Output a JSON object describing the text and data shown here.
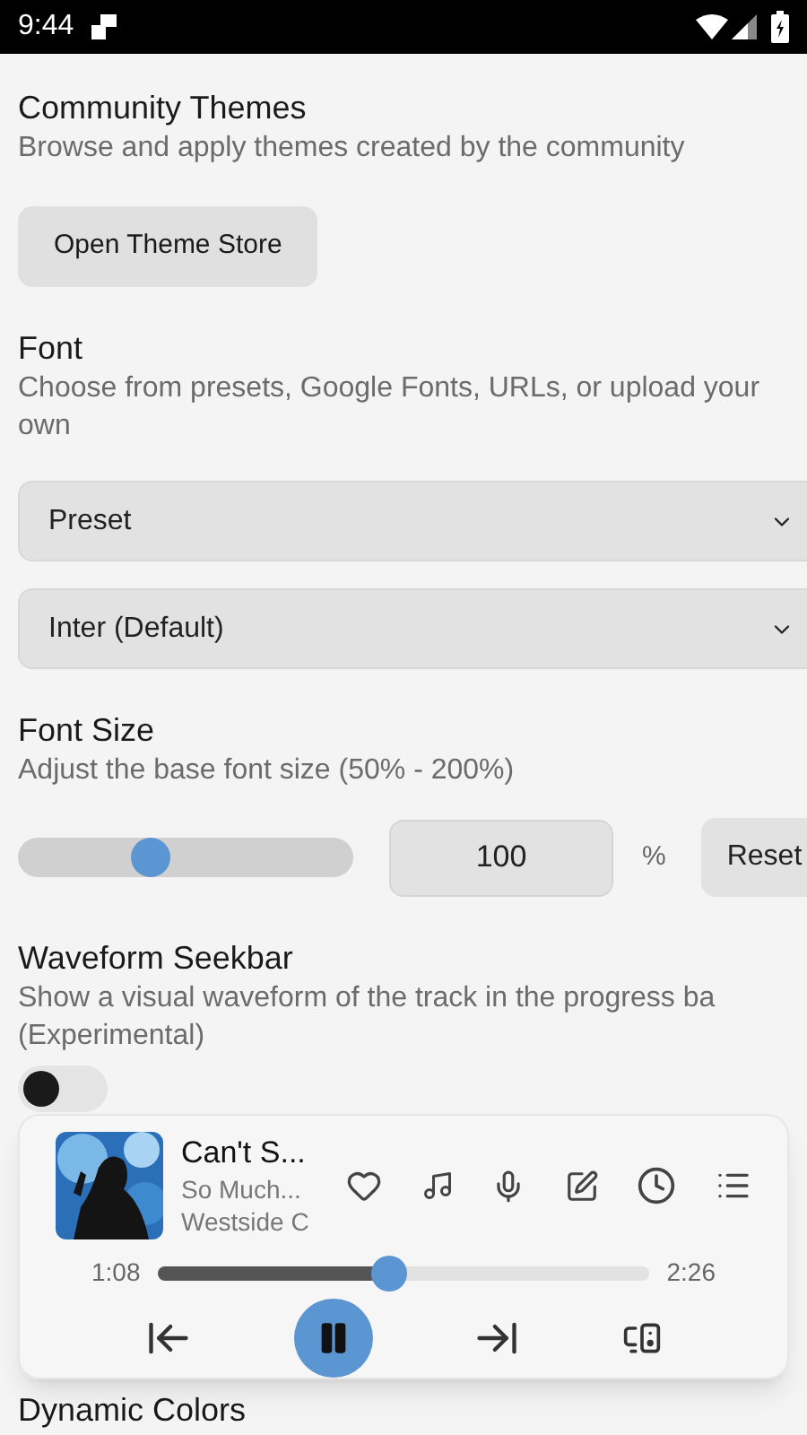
{
  "status_bar": {
    "time": "9:44"
  },
  "sections": [
    {
      "kind": "button",
      "title": "Community Themes",
      "description": "Browse and apply themes created by the community",
      "button": "Open Theme Store"
    },
    {
      "kind": "selects",
      "title": "Font",
      "description": "Choose from presets, Google Fonts, URLs, or upload your own",
      "selects": [
        "Preset",
        "Inter (Default)"
      ]
    },
    {
      "kind": "slider",
      "title": "Font Size",
      "description": "Adjust the base font size (50% - 200%)",
      "level": 0.38,
      "value": "100",
      "unit": "%",
      "reset": "Reset"
    },
    {
      "kind": "toggle",
      "title": "Waveform Seekbar",
      "description": "Show a visual waveform of the track in the progress ba\n(Experimental)",
      "on": false
    },
    {
      "kind": "heading",
      "title": "Dynamic Colors"
    }
  ],
  "player": {
    "title": "Can't S...",
    "album": "So Much...",
    "artist": "Westside C",
    "elapsed": "1:08",
    "duration": "2:26",
    "level": 0.47,
    "playing": true
  }
}
